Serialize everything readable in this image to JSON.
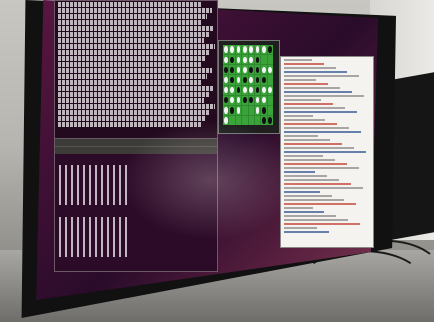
{
  "photo": {
    "subject": "",
    "terminal_top": {
      "title": "",
      "menu": ""
    },
    "terminal_bottom": {
      "title": "",
      "menu": ""
    },
    "board": {
      "rows": 8,
      "cols": 8
    },
    "colors": {
      "wall": "#c9c7c2",
      "desktop": "#3b0f33",
      "terminal": "#240a1e",
      "board": "#2f8a2f",
      "editor": "#f5f3ef"
    }
  }
}
